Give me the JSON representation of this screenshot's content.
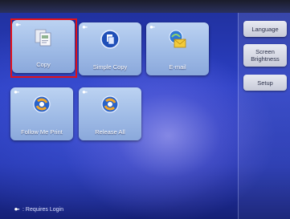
{
  "colors": {
    "highlight_box": "#e0121b",
    "tile_fill": "#a9c2ea",
    "screen_background": "#2b3fc4"
  },
  "tiles": [
    {
      "label": "Copy",
      "icon": "copy-icon",
      "highlighted": true
    },
    {
      "label": "Simple Copy",
      "icon": "simple-copy-icon"
    },
    {
      "label": "E-mail",
      "icon": "email-icon"
    },
    {
      "label": "Follow Me Print",
      "icon": "follow-me-print-icon"
    },
    {
      "label": "Release All",
      "icon": "release-all-icon"
    }
  ],
  "side_panel": {
    "language": "Language",
    "screen_brightness": "Screen Brightness",
    "setup": "Setup"
  },
  "footer": {
    "text": ": Requires Login",
    "icon": "key-icon"
  }
}
